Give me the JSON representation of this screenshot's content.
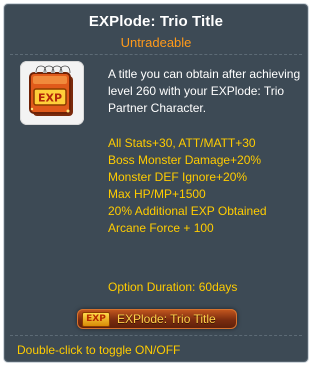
{
  "item": {
    "name": "EXPlode: Trio Title",
    "trade_status": "Untradeable",
    "icon": "exp-title-book-icon",
    "icon_label": "EXP",
    "description": "A title you can obtain after achieving level 260 with your EXPlode: Trio Partner Character.",
    "stats": [
      "All Stats+30, ATT/MATT+30",
      "Boss Monster Damage+20%",
      "Monster DEF Ignore+20%",
      "Max HP/MP+1500",
      "20% Additional EXP Obtained",
      "Arcane Force + 100"
    ],
    "duration": "Option Duration: 60days",
    "title_badge": {
      "icon_label": "EXP",
      "text": "EXPlode: Trio Title"
    },
    "hint": "Double-click to toggle ON/OFF"
  },
  "colors": {
    "panel": "#3d4a55",
    "title": "#ffffff",
    "untradeable": "#ff9a1a",
    "stat": "#ffcc00"
  }
}
